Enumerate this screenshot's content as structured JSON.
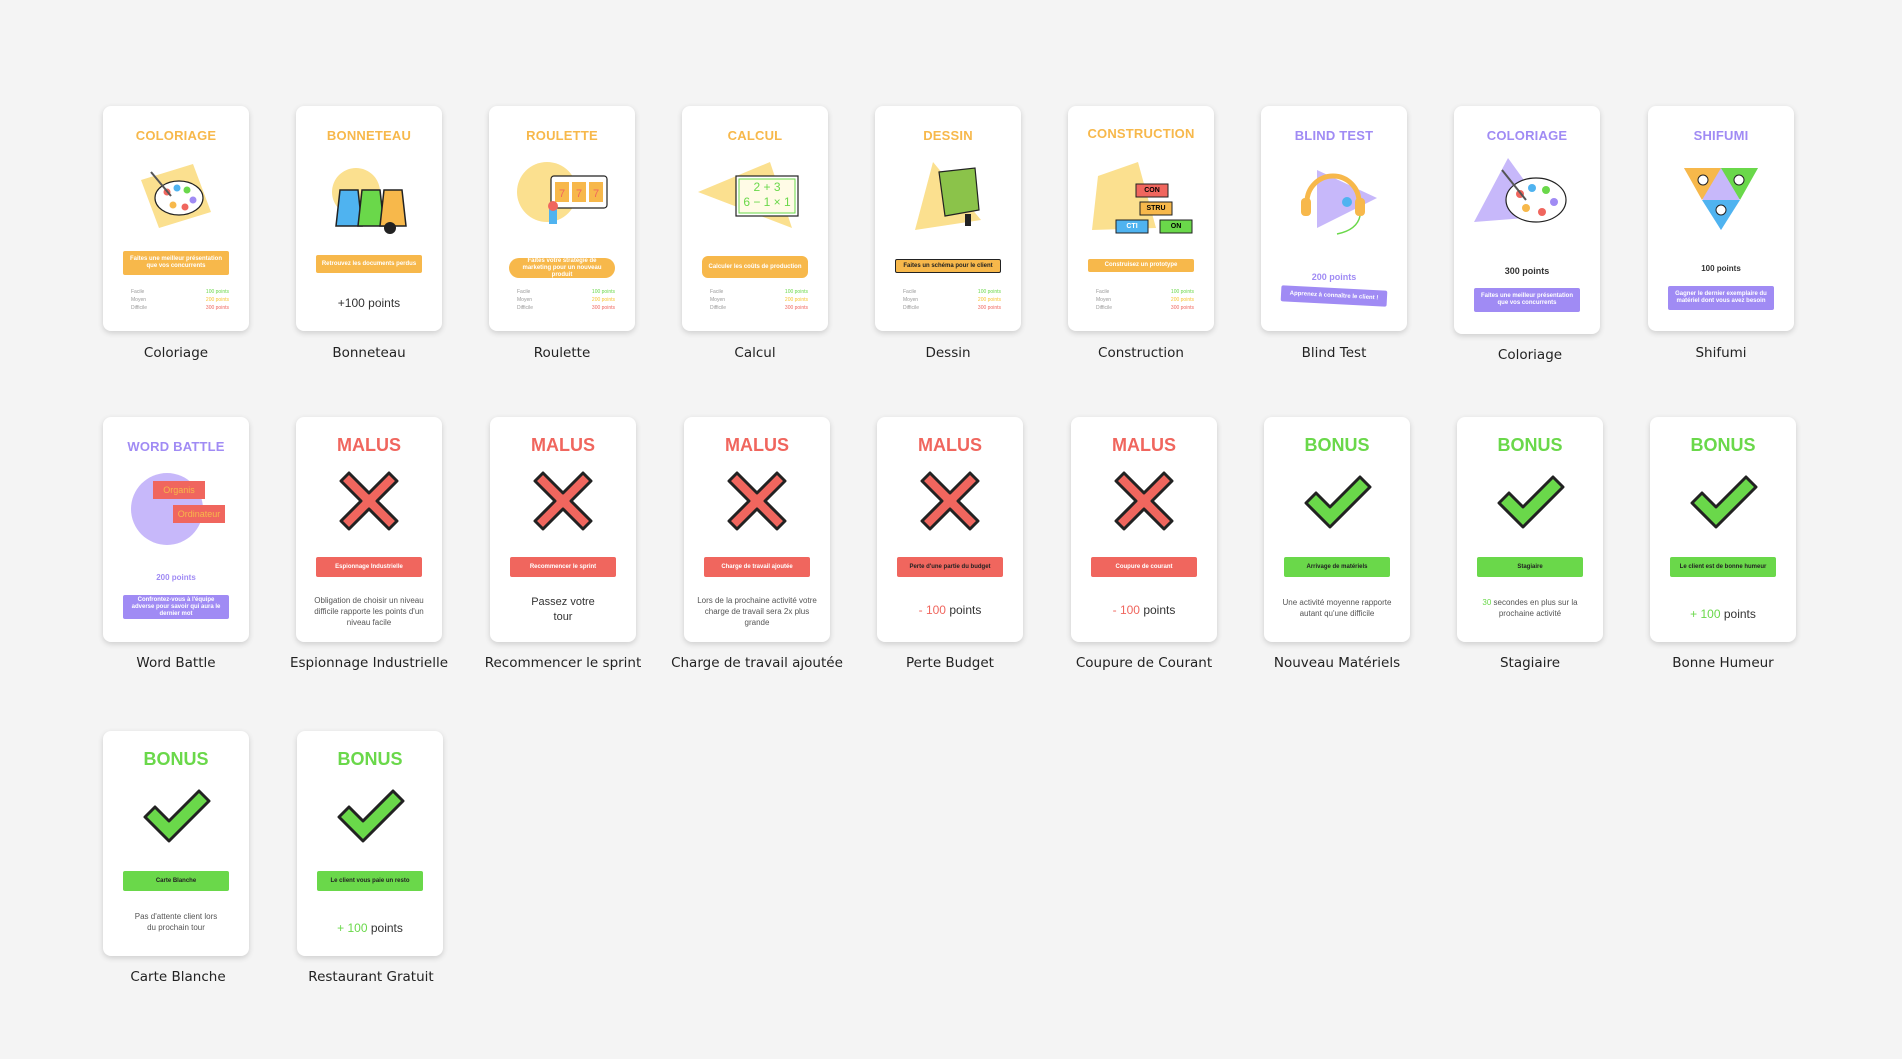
{
  "colors": {
    "orange": "#f7b84b",
    "purple": "#a08bf4",
    "malus": "#f0665e",
    "bonus": "#6ad84a",
    "yellow": "#fbe08f"
  },
  "row1": [
    {
      "title": "COLORIAGE",
      "caption": "Coloriage",
      "bar": "Faites une meilleur présentation que vos concurrents",
      "diff": [
        [
          "Facile",
          "100 points"
        ],
        [
          "Moyen",
          "200 points"
        ],
        [
          "Difficile",
          "300 points"
        ]
      ],
      "icon": "palette-icon"
    },
    {
      "title": "BONNETEAU",
      "caption": "Bonneteau",
      "bar": "Retrouvez les documents perdus",
      "points": "+100 points",
      "icon": "cups-icon"
    },
    {
      "title": "ROULETTE",
      "caption": "Roulette",
      "bar": "Faites votre stratégie de marketing pour un nouveau produit",
      "diff": [
        [
          "Facile",
          "100 points"
        ],
        [
          "Moyen",
          "200 points"
        ],
        [
          "Difficile",
          "300 points"
        ]
      ],
      "icon": "slot-machine-icon"
    },
    {
      "title": "CALCUL",
      "caption": "Calcul",
      "bar": "Calculer les coûts de production",
      "diff": [
        [
          "Facile",
          "100 points"
        ],
        [
          "Moyen",
          "200 points"
        ],
        [
          "Difficile",
          "300 points"
        ]
      ],
      "icon": "math-board-icon",
      "board": [
        "2 + 3",
        "6 − 1 × 1"
      ]
    },
    {
      "title": "DESSIN",
      "caption": "Dessin",
      "bar": "Faites un schéma pour le client",
      "diff": [
        [
          "Facile",
          "100 points"
        ],
        [
          "Moyen",
          "200 points"
        ],
        [
          "Difficile",
          "300 points"
        ]
      ],
      "icon": "drawing-book-icon"
    },
    {
      "title": "CONSTRUCTION",
      "caption": "Construction",
      "bar": "Construisez un prototype",
      "diff": [
        [
          "Facile",
          "100 points"
        ],
        [
          "Moyen",
          "200 points"
        ],
        [
          "Difficile",
          "300 points"
        ]
      ],
      "icon": "blocks-icon",
      "blocks": [
        "CON",
        "STRU",
        "CTI",
        "ON"
      ]
    },
    {
      "title": "BLIND TEST",
      "caption": "Blind Test",
      "points": "200 points",
      "bar": "Apprenez à connaître le client !",
      "icon": "headphones-icon"
    },
    {
      "title": "COLORIAGE",
      "caption": "Coloriage",
      "points": "300 points",
      "bar": "Faites une meilleur présentation que vos concurrents",
      "icon": "palette-icon"
    },
    {
      "title": "SHIFUMI",
      "caption": "Shifumi",
      "points": "100 points",
      "bar": "Gagner le dernier exemplaire du matériel dont vous avez besoin",
      "icon": "rock-paper-scissors-icon"
    }
  ],
  "wordbattle": {
    "title": "WORD BATTLE",
    "caption": "Word Battle",
    "points": "200 points",
    "bar": "Confrontez-vous à l'équipe adverse pour savoir qui aura le dernier mot",
    "bubbles": [
      "Organis",
      "Ordinateur"
    ]
  },
  "malus": [
    {
      "title": "MALUS",
      "caption": "Espionnage Industrielle",
      "bar": "Espionnage Industrielle",
      "body": "Obligation de choisir un niveau difficile rapporte les points d'un niveau facile"
    },
    {
      "title": "MALUS",
      "caption": "Recommencer le sprint",
      "bar": "Recommencer le sprint",
      "body": "Passez votre tour"
    },
    {
      "title": "MALUS",
      "caption": "Charge de travail ajoutée",
      "bar": "Charge de travail ajoutée",
      "body": "Lors de la prochaine activité votre charge de travail sera 2x plus grande"
    },
    {
      "title": "MALUS",
      "caption": "Perte Budget",
      "bar": "Perte d'une partie du budget",
      "pts_prefix": "- 100",
      "pts_suffix": "points"
    },
    {
      "title": "MALUS",
      "caption": "Coupure de Courant",
      "bar": "Coupure de courant",
      "pts_prefix": "- 100",
      "pts_suffix": "points"
    }
  ],
  "bonus": [
    {
      "title": "BONUS",
      "caption": "Nouveau Matériels",
      "bar": "Arrivage de matériels",
      "body": "Une activité moyenne rapporte autant qu'une difficile"
    },
    {
      "title": "BONUS",
      "caption": "Stagiaire",
      "bar": "Stagiaire",
      "body_prefix": "30",
      "body": "secondes en plus sur la prochaine activité"
    },
    {
      "title": "BONUS",
      "caption": "Bonne Humeur",
      "bar": "Le client est de bonne humeur",
      "pts_prefix": "+ 100",
      "pts_suffix": "points"
    },
    {
      "title": "BONUS",
      "caption": "Carte Blanche",
      "bar": "Carte Blanche",
      "body": "Pas d'attente client lors du prochain tour"
    },
    {
      "title": "BONUS",
      "caption": "Restaurant Gratuit",
      "bar": "Le client vous paie un resto",
      "pts_prefix": "+ 100",
      "pts_suffix": "points"
    }
  ]
}
